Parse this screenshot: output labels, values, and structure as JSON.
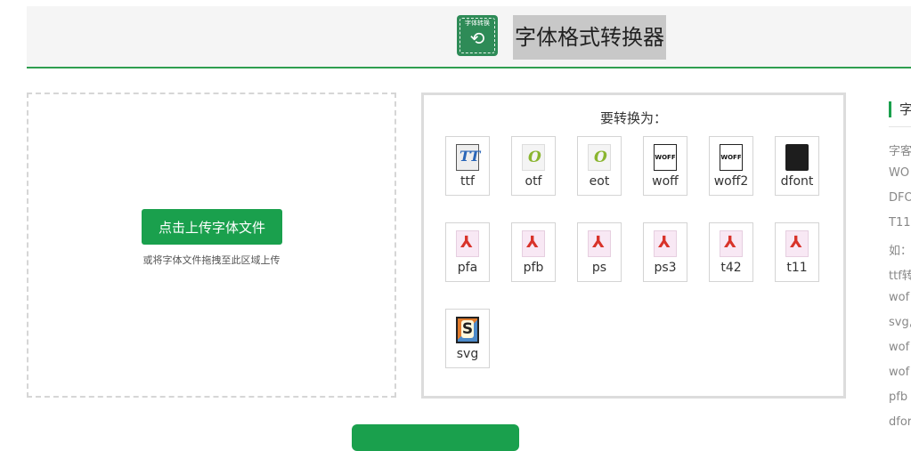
{
  "header": {
    "logo_text": "字体转换",
    "logo_arrows": "⟲",
    "title": "字体格式转换器"
  },
  "upload": {
    "button_label": "点击上传字体文件",
    "hint": "或将字体文件拖拽至此区域上传"
  },
  "formats": {
    "title": "要转换为：",
    "items": [
      {
        "label": "ttf",
        "icon": "ttf-icon",
        "glyph": "TT"
      },
      {
        "label": "otf",
        "icon": "otf-icon",
        "glyph": "O"
      },
      {
        "label": "eot",
        "icon": "eot-icon",
        "glyph": "O"
      },
      {
        "label": "woff",
        "icon": "woff-icon",
        "glyph": "WOFF"
      },
      {
        "label": "woff2",
        "icon": "woff2-icon",
        "glyph": "WOFF"
      },
      {
        "label": "dfont",
        "icon": "dfont-icon",
        "glyph": ""
      },
      {
        "label": "pfa",
        "icon": "pdf-icon",
        "glyph": "⅄"
      },
      {
        "label": "pfb",
        "icon": "pdf-icon",
        "glyph": "⅄"
      },
      {
        "label": "ps",
        "icon": "pdf-icon",
        "glyph": "⅄"
      },
      {
        "label": "ps3",
        "icon": "pdf-icon",
        "glyph": "⅄"
      },
      {
        "label": "t42",
        "icon": "pdf-icon",
        "glyph": "⅄"
      },
      {
        "label": "t11",
        "icon": "pdf-icon",
        "glyph": "⅄"
      },
      {
        "label": "svg",
        "icon": "svg-icon",
        "glyph": "S"
      }
    ]
  },
  "sidebar": {
    "heading": "字",
    "lines": [
      "字客",
      "WO",
      "DFO",
      "T11",
      "如：",
      "ttf转",
      "wof",
      "svg,",
      "wof",
      "wof",
      "pfb",
      "dfor"
    ]
  },
  "colors": {
    "accent": "#1aa04d",
    "header_border": "#2f9e4f",
    "title_highlight": "#c8c8c8"
  }
}
